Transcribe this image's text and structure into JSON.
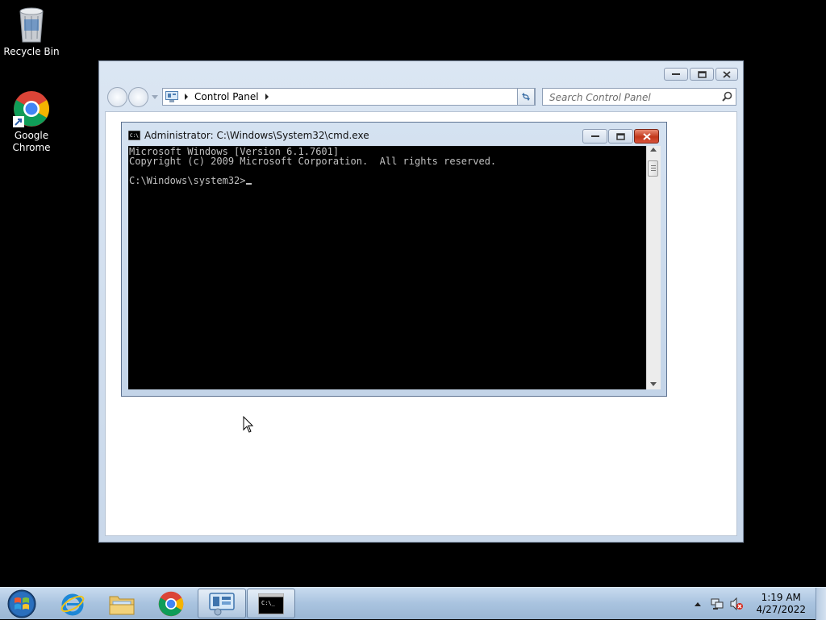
{
  "desktop": {
    "icons": [
      {
        "label": "Recycle Bin",
        "icon": "recycle-bin-icon"
      },
      {
        "label": "Google Chrome",
        "icon": "chrome-icon"
      }
    ]
  },
  "control_panel": {
    "breadcrumb": [
      "Control Panel"
    ],
    "search_placeholder": "Search Control Panel"
  },
  "cmd": {
    "title": "Administrator: C:\\Windows\\System32\\cmd.exe",
    "lines": [
      "Microsoft Windows [Version 6.1.7601]",
      "Copyright (c) 2009 Microsoft Corporation.  All rights reserved.",
      "",
      "C:\\Windows\\system32>"
    ],
    "close_color": "#c2381b"
  },
  "taskbar": {
    "pinned": [
      "start-orb-icon",
      "internet-explorer-icon",
      "windows-explorer-icon",
      "chrome-icon",
      "control-panel-icon",
      "cmd-icon"
    ],
    "clock": {
      "time": "1:19 AM",
      "date": "4/27/2022"
    }
  }
}
